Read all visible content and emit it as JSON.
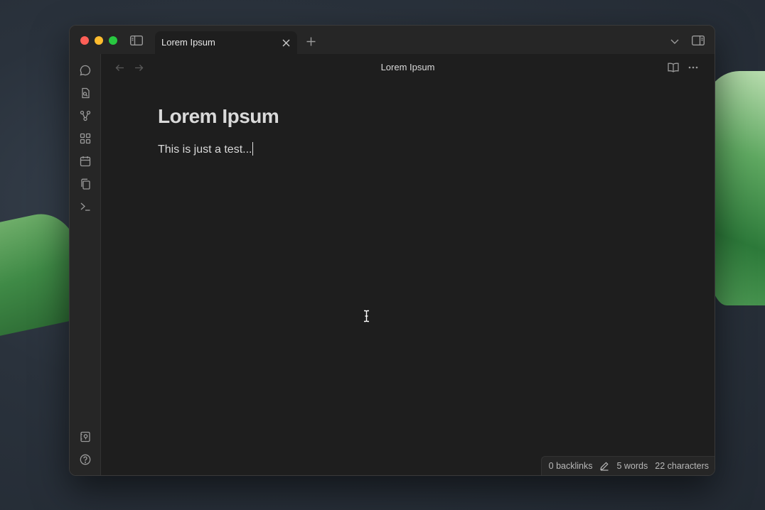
{
  "window": {
    "tab_title": "Lorem Ipsum",
    "view_title": "Lorem Ipsum"
  },
  "note": {
    "title": "Lorem Ipsum",
    "body": "This is just a test..."
  },
  "status": {
    "backlinks": "0 backlinks",
    "words": "5 words",
    "characters": "22 characters"
  },
  "ribbon": {
    "top_icons": [
      "chat-icon",
      "file-search-icon",
      "graph-icon",
      "blocks-icon",
      "calendar-icon",
      "copy-icon",
      "terminal-icon"
    ],
    "bottom_icons": [
      "vault-icon",
      "help-icon",
      "settings-icon"
    ]
  },
  "colors": {
    "background": "#1e1e1e",
    "chrome": "#262626",
    "text": "#dadada",
    "traffic_red": "#fe5f57",
    "traffic_yellow": "#febc2e",
    "traffic_green": "#28c840"
  }
}
